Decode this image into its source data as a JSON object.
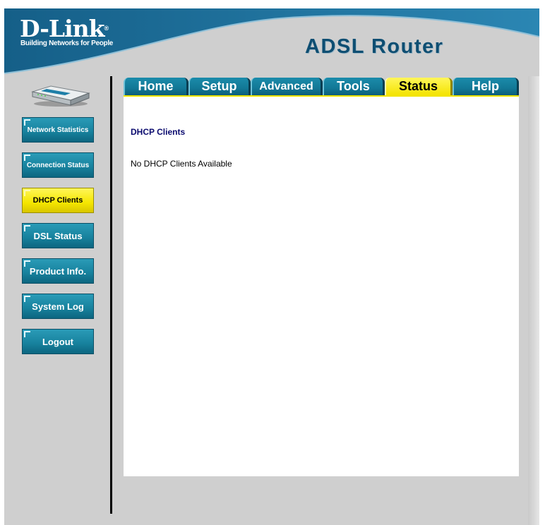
{
  "brand": {
    "logo_text": "D-Link",
    "registered_mark": "®",
    "tagline": "Building Networks for People",
    "product_title": "ADSL Router"
  },
  "colors": {
    "header_blue": "#1a6f9b",
    "tab_teal": "#127896",
    "active_yellow": "#f5e600",
    "panel_gray": "#cfcfcf",
    "section_title": "#0a0a6e"
  },
  "tabs": [
    {
      "label": "Home",
      "active": false
    },
    {
      "label": "Setup",
      "active": false
    },
    {
      "label": "Advanced",
      "active": false
    },
    {
      "label": "Tools",
      "active": false
    },
    {
      "label": "Status",
      "active": true
    },
    {
      "label": "Help",
      "active": false
    }
  ],
  "sidebar": {
    "device_image": "adsl-router-device-icon",
    "items": [
      {
        "label": "Network Statistics",
        "active": false
      },
      {
        "label": "Connection Status",
        "active": false
      },
      {
        "label": "DHCP Clients",
        "active": true
      },
      {
        "label": "DSL Status",
        "active": false
      },
      {
        "label": "Product Info.",
        "active": false
      },
      {
        "label": "System Log",
        "active": false
      },
      {
        "label": "Logout",
        "active": false
      }
    ]
  },
  "main": {
    "section_title": "DHCP Clients",
    "message": "No DHCP Clients Available"
  }
}
